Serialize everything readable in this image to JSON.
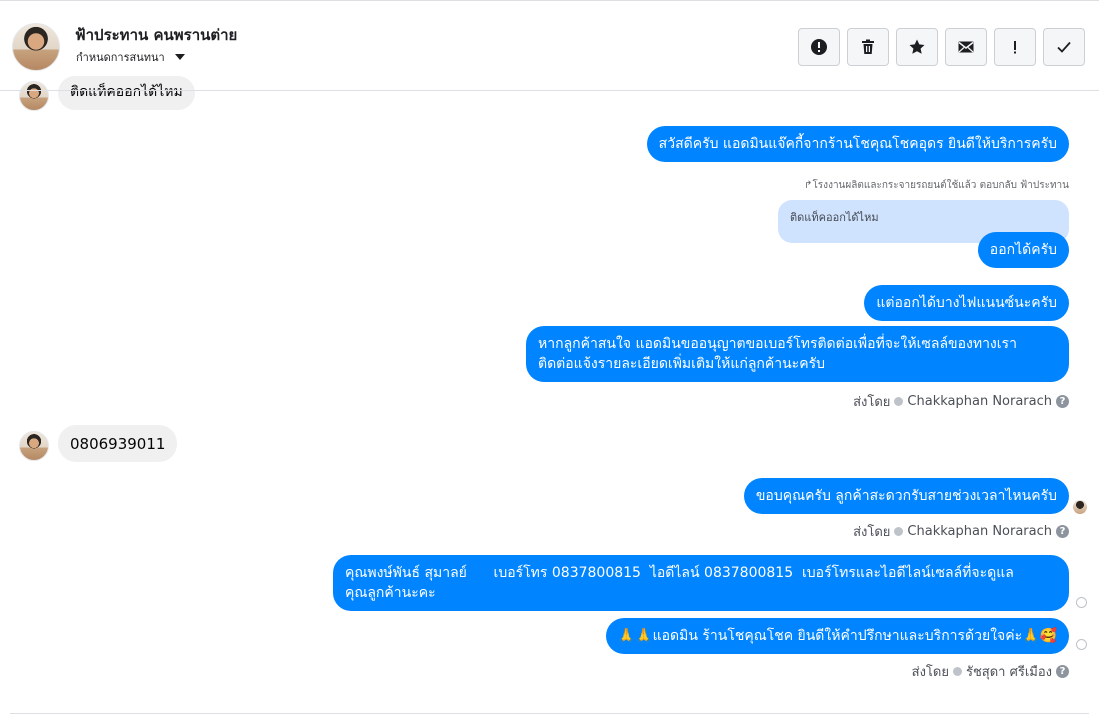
{
  "header": {
    "name": "ฟ้าประทาน คนพรานต่าย",
    "subtitle": "กำหนดการสนทนา"
  },
  "toolbar": {
    "buttons": [
      {
        "name": "spam-button",
        "icon": "alert-circle-icon"
      },
      {
        "name": "delete-button",
        "icon": "trash-icon"
      },
      {
        "name": "star-button",
        "icon": "star-icon"
      },
      {
        "name": "mark-unread-button",
        "icon": "envelope-icon"
      },
      {
        "name": "important-button",
        "icon": "exclamation-icon"
      },
      {
        "name": "done-button",
        "icon": "check-icon"
      }
    ]
  },
  "messages": {
    "m0": "ติดแท็คออกได้ไหม",
    "m1": "สวัสดีครับ แอดมินแจ๊คกี้จากร้านโชคุณโชคอุดร ยินดีให้บริการครับ",
    "reply_note": "โรงงานผลิตและกระจายรถยนต์ใช้แล้ว ตอบกลับ ฟ้าประทาน",
    "quoted": "ติดแท็คออกได้ไหม",
    "m2": "ออกได้ครับ",
    "m3": "แต่ออกได้บางไฟแนนซ์นะครับ",
    "m4_line1": "หากลูกค้าสนใจ แอดมินขออนุญาตขอเบอร์โทรติดต่อเพื่อที่จะให้เซลล์ของทางเรา",
    "m4_line2": "ติดต่อแจ้งรายละเอียดเพิ่มเติมให้แก่ลูกค้านะครับ",
    "sent_by_1_label": "ส่งโดย",
    "sent_by_1_name": "Chakkaphan Norarach",
    "m5": "0806939011",
    "m6": "ขอบคุณครับ ลูกค้าสะดวกรับสายช่วงเวลาไหนครับ",
    "sent_by_2_label": "ส่งโดย",
    "sent_by_2_name": "Chakkaphan Norarach",
    "m7_line1": "คุณพงษ์พันธ์ สุมาลย์      เบอร์โทร 0837800815  ไอดีไลน์ 0837800815  เบอร์โทรและไอดีไลน์เซลล์ที่จะดูแล",
    "m7_line2": "คุณลูกค้านะคะ",
    "m8": "🙏🙏แอดมิน ร้านโชคุณโชค ยินดีให้คำปรึกษาและบริการด้วยใจค่ะ🙏🥰",
    "sent_by_3_label": "ส่งโดย",
    "sent_by_3_name": "รัชสุดา ศรีเมือง"
  },
  "colors": {
    "outgoing_bubble": "#0084ff",
    "incoming_bubble": "#f1f0f0",
    "quoted_bubble": "#cfe3ff"
  }
}
